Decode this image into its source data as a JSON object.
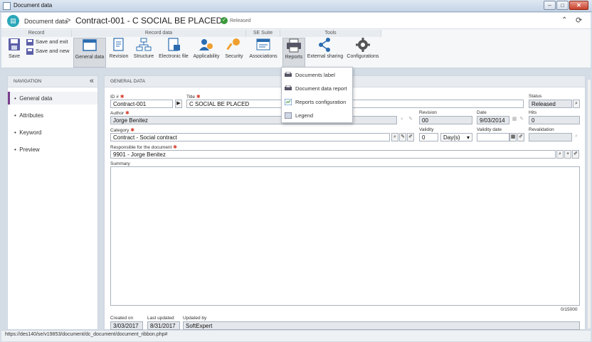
{
  "window": {
    "title": "Document data"
  },
  "header": {
    "module": "Document data",
    "separator": ">",
    "doc_title": "Contract-001 - C SOCIAL BE PLACED",
    "bar": "|",
    "status": "Released"
  },
  "ribbon": {
    "groups": {
      "record": "Record",
      "record_data": "Record data",
      "se_suite": "SE Suite",
      "tools": "Tools"
    },
    "save": "Save",
    "save_exit": "Save and exit",
    "save_new": "Save and new",
    "general_data": "General data",
    "revision": "Revision",
    "structure": "Structure",
    "electronic_file": "Electronic file",
    "applicability": "Applicability",
    "security": "Security",
    "associations": "Associations",
    "reports": "Reports",
    "external_sharing": "External sharing",
    "configurations": "Configurations"
  },
  "reports_menu": {
    "items": [
      "Documents label",
      "Document data report",
      "Reports configuration",
      "Legend"
    ]
  },
  "navigation": {
    "heading": "NAVIGATION",
    "items": [
      "General data",
      "Attributes",
      "Keyword",
      "Preview"
    ]
  },
  "form": {
    "heading": "GENERAL DATA",
    "id_label": "ID #",
    "id_value": "Contract-001",
    "title_label": "Title",
    "title_value": "C SOCIAL BE PLACED",
    "status_label": "Status",
    "status_value": "Released",
    "author_label": "Author",
    "author_value": "Jorge Benitez",
    "revision_label": "Revision",
    "revision_value": "00",
    "date_label": "Date",
    "date_value": "9/03/2014",
    "hits_label": "Hits",
    "hits_value": "0",
    "category_label": "Category",
    "category_value": "Contract - Social contract",
    "validity_label": "Validity",
    "validity_value": "0",
    "validity_unit": "Day(s)",
    "validity_date_label": "Validity date",
    "revalidation_label": "Revalidation",
    "responsible_label": "Responsible for the document",
    "responsible_value": "9901 - Jorge Benitez",
    "summary_label": "Summary",
    "summary_counter": "0/15000",
    "created_label": "Created on",
    "created_value": "3/03/2017",
    "updated_label": "Last updated",
    "updated_value": "8/31/2017",
    "updated_by_label": "Updated by",
    "updated_by_value": "SoftExpert"
  },
  "statusbar": {
    "url": "https://des140/se/v19853/document/dc_document/document_ribbon.php#"
  },
  "colors": {
    "accent_teal": "#2aa7b8",
    "status_green": "#3c9a3c",
    "nav_active": "#7a3e8e",
    "required": "#d63a2a"
  }
}
